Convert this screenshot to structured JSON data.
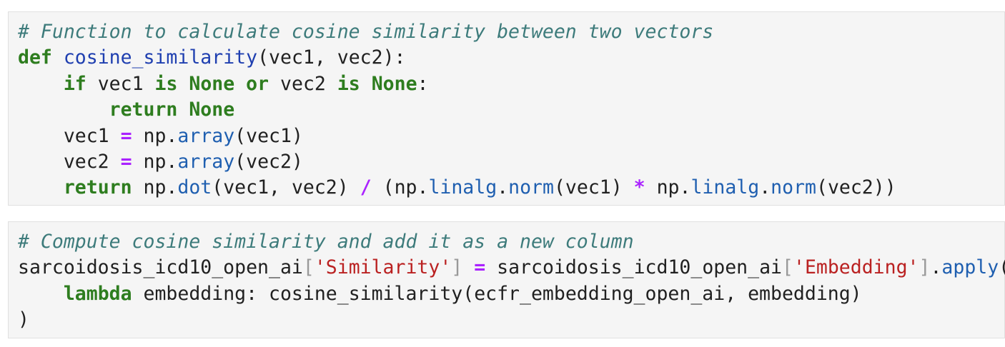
{
  "cells": [
    {
      "lines": [
        [
          {
            "text": "# Function to calculate cosine similarity between two vectors",
            "kind": "comment"
          }
        ],
        [
          {
            "text": "def",
            "kind": "kw"
          },
          {
            "text": " ",
            "kind": "plain"
          },
          {
            "text": "cosine_similarity",
            "kind": "fn"
          },
          {
            "text": "(vec1, vec2):",
            "kind": "plain"
          }
        ],
        [
          {
            "text": "    ",
            "kind": "plain"
          },
          {
            "text": "if",
            "kind": "kw"
          },
          {
            "text": " vec1 ",
            "kind": "plain"
          },
          {
            "text": "is",
            "kind": "kw"
          },
          {
            "text": " ",
            "kind": "plain"
          },
          {
            "text": "None",
            "kind": "kw"
          },
          {
            "text": " ",
            "kind": "plain"
          },
          {
            "text": "or",
            "kind": "kw"
          },
          {
            "text": " vec2 ",
            "kind": "plain"
          },
          {
            "text": "is",
            "kind": "kw"
          },
          {
            "text": " ",
            "kind": "plain"
          },
          {
            "text": "None",
            "kind": "kw"
          },
          {
            "text": ":",
            "kind": "plain"
          }
        ],
        [
          {
            "text": "        ",
            "kind": "plain"
          },
          {
            "text": "return",
            "kind": "kw"
          },
          {
            "text": " ",
            "kind": "plain"
          },
          {
            "text": "None",
            "kind": "kw"
          }
        ],
        [
          {
            "text": "    vec1 ",
            "kind": "plain"
          },
          {
            "text": "=",
            "kind": "op"
          },
          {
            "text": " np.",
            "kind": "plain"
          },
          {
            "text": "array",
            "kind": "attr"
          },
          {
            "text": "(vec1)",
            "kind": "plain"
          }
        ],
        [
          {
            "text": "    vec2 ",
            "kind": "plain"
          },
          {
            "text": "=",
            "kind": "op"
          },
          {
            "text": " np.",
            "kind": "plain"
          },
          {
            "text": "array",
            "kind": "attr"
          },
          {
            "text": "(vec2)",
            "kind": "plain"
          }
        ],
        [
          {
            "text": "    ",
            "kind": "plain"
          },
          {
            "text": "return",
            "kind": "kw"
          },
          {
            "text": " np.",
            "kind": "plain"
          },
          {
            "text": "dot",
            "kind": "attr"
          },
          {
            "text": "(vec1, vec2) ",
            "kind": "plain"
          },
          {
            "text": "/",
            "kind": "op"
          },
          {
            "text": " (np.",
            "kind": "plain"
          },
          {
            "text": "linalg",
            "kind": "attr"
          },
          {
            "text": ".",
            "kind": "plain"
          },
          {
            "text": "norm",
            "kind": "attr"
          },
          {
            "text": "(vec1) ",
            "kind": "plain"
          },
          {
            "text": "*",
            "kind": "op"
          },
          {
            "text": " np.",
            "kind": "plain"
          },
          {
            "text": "linalg",
            "kind": "attr"
          },
          {
            "text": ".",
            "kind": "plain"
          },
          {
            "text": "norm",
            "kind": "attr"
          },
          {
            "text": "(vec2))",
            "kind": "plain"
          }
        ]
      ]
    },
    {
      "lines": [
        [
          {
            "text": "# Compute cosine similarity and add it as a new column",
            "kind": "comment"
          }
        ],
        [
          {
            "text": "sarcoidosis_icd10_open_ai",
            "kind": "plain"
          },
          {
            "text": "[",
            "kind": "brk"
          },
          {
            "text": "'Similarity'",
            "kind": "str"
          },
          {
            "text": "]",
            "kind": "brk"
          },
          {
            "text": " ",
            "kind": "plain"
          },
          {
            "text": "=",
            "kind": "op"
          },
          {
            "text": " sarcoidosis_icd10_open_ai",
            "kind": "plain"
          },
          {
            "text": "[",
            "kind": "brk"
          },
          {
            "text": "'Embedding'",
            "kind": "str"
          },
          {
            "text": "]",
            "kind": "brk"
          },
          {
            "text": ".",
            "kind": "plain"
          },
          {
            "text": "apply",
            "kind": "attr"
          },
          {
            "text": "(",
            "kind": "plain"
          }
        ],
        [
          {
            "text": "    ",
            "kind": "plain"
          },
          {
            "text": "lambda",
            "kind": "kw"
          },
          {
            "text": " embedding: cosine_similarity(ecfr_embedding_open_ai, embedding)",
            "kind": "plain"
          }
        ],
        [
          {
            "text": ")",
            "kind": "plain"
          }
        ]
      ]
    }
  ]
}
